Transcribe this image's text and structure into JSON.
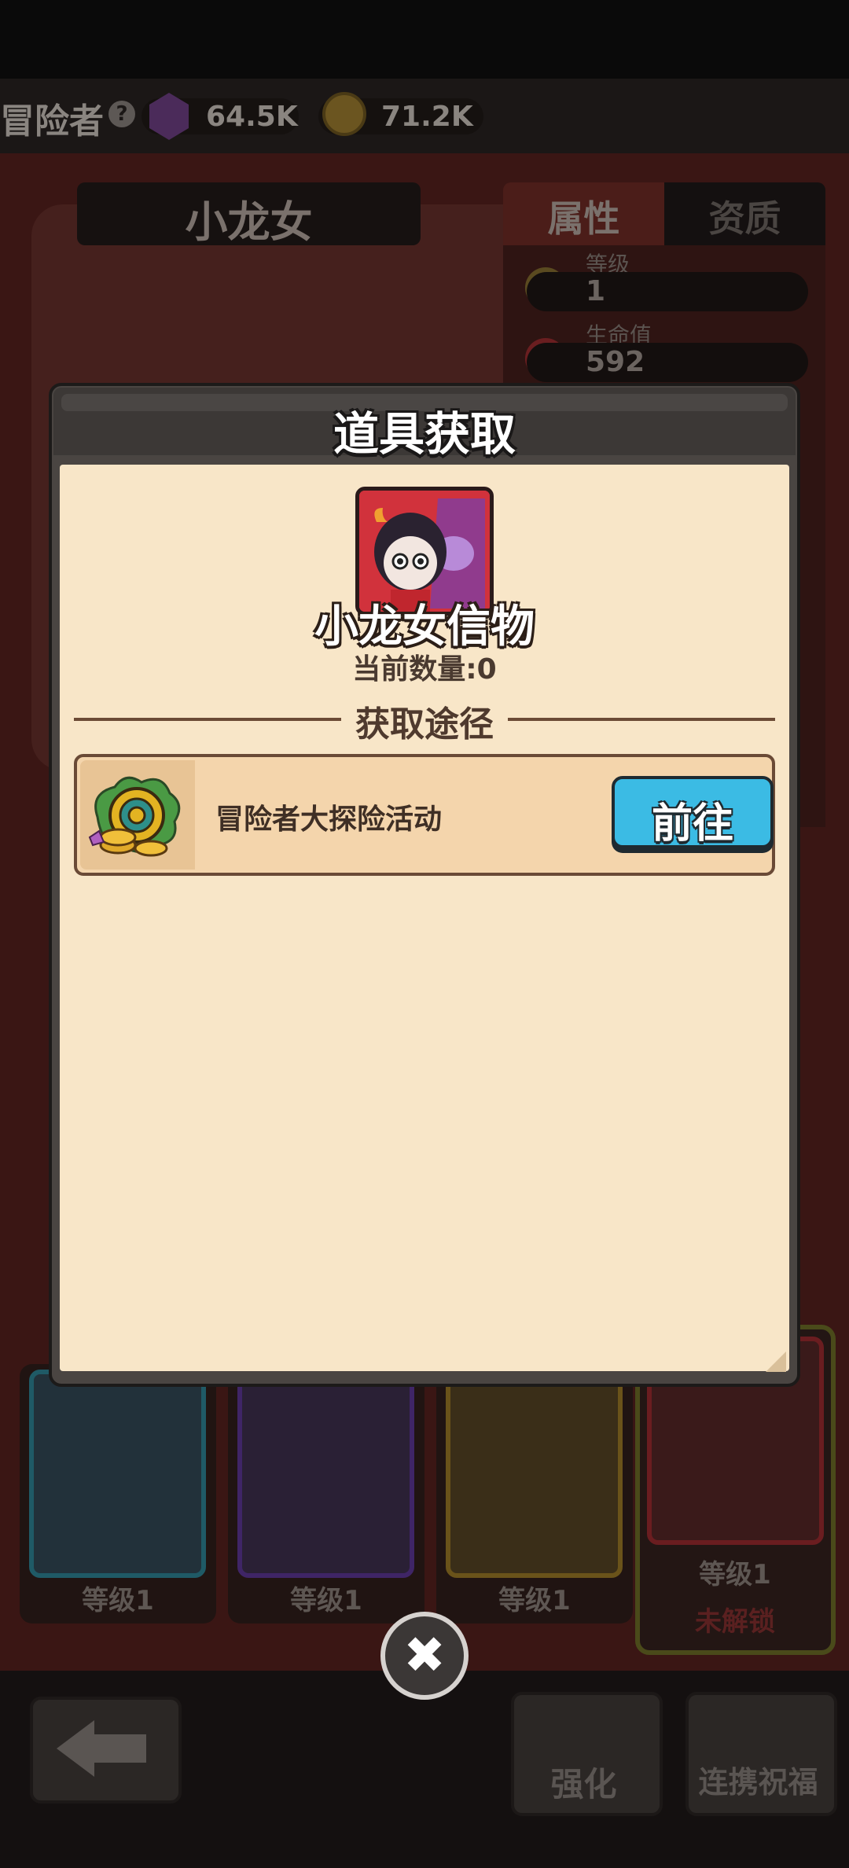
{
  "resource_bar": {
    "title": "冒险者",
    "help_icon": "?",
    "gems_value": "64.5K",
    "coins_value": "71.2K"
  },
  "hero": {
    "name": "小龙女"
  },
  "attributes_panel": {
    "tab_attributes": "属性",
    "tab_quality": "资质",
    "level_label": "等级",
    "level_value": "1",
    "hp_label": "生命值",
    "hp_value": "592"
  },
  "hero_cards": [
    {
      "level": "等级1",
      "border": "#1f6b7a"
    },
    {
      "level": "等级1",
      "border": "#4d2a7a"
    },
    {
      "level": "等级1",
      "border": "#8a6a1a"
    },
    {
      "level": "等级1",
      "status": "未解锁",
      "border": "#7a1f22"
    }
  ],
  "bottom_bar": {
    "enhance_label": "强化",
    "blessing_label": "连携祝福"
  },
  "modal": {
    "title": "道具获取",
    "item_name": "小龙女信物",
    "quantity_text": "当前数量:0",
    "section_title": "获取途径",
    "sources": [
      {
        "label": "冒险者大探险活动",
        "button_label": "前往"
      }
    ],
    "close_symbol": "✖"
  },
  "colors": {
    "modal_bg": "#f8e6c8",
    "go_button": "#3bbbe4",
    "item_card": "#d1323c"
  }
}
